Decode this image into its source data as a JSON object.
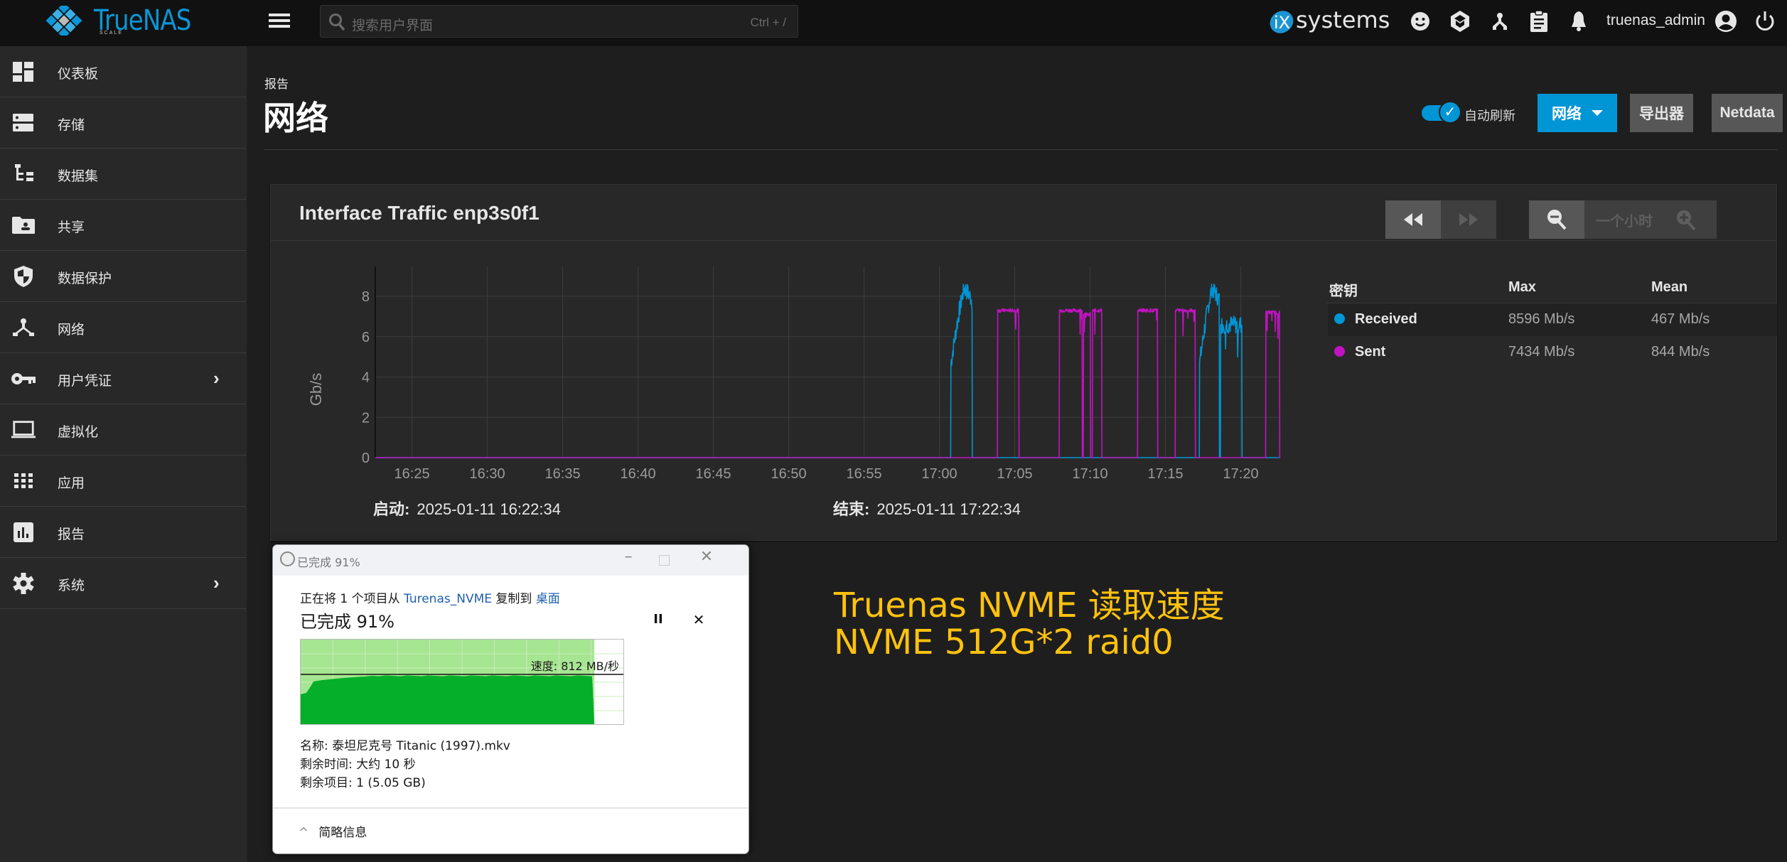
{
  "topbar": {
    "brand": "TrueNAS",
    "brand_sub": "SCALE",
    "search_placeholder": "搜索用户界面",
    "search_hint": "Ctrl + /",
    "vendor": "systems",
    "vendor_prefix": "iX",
    "username": "truenas_admin",
    "icons": [
      "feedback-icon",
      "truecommand-icon",
      "network-status-icon",
      "jobs-clipboard-icon",
      "notifications-bell-icon",
      "account-icon",
      "power-icon"
    ]
  },
  "sidebar": {
    "items": [
      {
        "label": "仪表板",
        "icon": "dashboard-icon",
        "has_children": false
      },
      {
        "label": "存储",
        "icon": "storage-icon",
        "has_children": false
      },
      {
        "label": "数据集",
        "icon": "datasets-icon",
        "has_children": false
      },
      {
        "label": "共享",
        "icon": "shares-icon",
        "has_children": false
      },
      {
        "label": "数据保护",
        "icon": "shield-icon",
        "has_children": false
      },
      {
        "label": "网络",
        "icon": "network-icon",
        "has_children": false
      },
      {
        "label": "用户凭证",
        "icon": "key-icon",
        "has_children": true
      },
      {
        "label": "虚拟化",
        "icon": "laptop-icon",
        "has_children": false
      },
      {
        "label": "应用",
        "icon": "apps-grid-icon",
        "has_children": false
      },
      {
        "label": "报告",
        "icon": "reports-icon",
        "has_children": false
      },
      {
        "label": "系统",
        "icon": "gear-icon",
        "has_children": true
      }
    ]
  },
  "page": {
    "breadcrumb": "报告",
    "title": "网络",
    "auto_refresh_label": "自动刷新",
    "auto_refresh_on": true,
    "report_select_label": "网络",
    "exporters_label": "导出器",
    "netdata_label": "Netdata"
  },
  "card": {
    "title": "Interface Traffic enp3s0f1",
    "zoom_label": "一个小时",
    "start_label": "启动:",
    "start_value": "2025-01-11 16:22:34",
    "end_label": "结束:",
    "end_value": "2025-01-11 17:22:34",
    "legend": {
      "key_header": "密钥",
      "max_header": "Max",
      "mean_header": "Mean",
      "rows": [
        {
          "name": "Received",
          "color": "#0095d5",
          "max": "8596 Mb/s",
          "mean": "467 Mb/s"
        },
        {
          "name": "Sent",
          "color": "#c213c2",
          "max": "7434 Mb/s",
          "mean": "844 Mb/s"
        }
      ]
    }
  },
  "chart_data": {
    "type": "line",
    "title": "Interface Traffic enp3s0f1",
    "xlabel": "",
    "ylabel": "Gb/s",
    "x_range": [
      "16:22:34",
      "17:22:34"
    ],
    "x_ticks": [
      "16:25",
      "16:30",
      "16:35",
      "16:40",
      "16:45",
      "16:50",
      "16:55",
      "17:00",
      "17:05",
      "17:10",
      "17:15",
      "17:20"
    ],
    "y_ticks": [
      0,
      2,
      4,
      6,
      8
    ],
    "ylim": [
      0,
      9.5
    ],
    "grid": true,
    "legend_position": "right",
    "series": [
      {
        "name": "Received",
        "color": "#0095d5",
        "bursts": [
          {
            "start_min": 38.2,
            "end_min": 39.6,
            "level": 7.8,
            "peak": 8.6,
            "ramp": true
          },
          {
            "start_min": 54.7,
            "end_min": 56.0,
            "level": 7.8,
            "peak": 8.6,
            "ramp": true
          },
          {
            "start_min": 56.1,
            "end_min": 57.5,
            "level": 6.6,
            "peak": 7.6,
            "ramp": false
          }
        ]
      },
      {
        "name": "Sent",
        "color": "#c213c2",
        "bursts": [
          {
            "start_min": 41.3,
            "end_min": 42.7,
            "level": 7.3,
            "peak": 7.43,
            "ramp": false
          },
          {
            "start_min": 45.4,
            "end_min": 46.9,
            "level": 7.3,
            "peak": 7.43,
            "ramp": false
          },
          {
            "start_min": 47.0,
            "end_min": 47.45,
            "level": 7.1,
            "peak": 7.2,
            "ramp": false
          },
          {
            "start_min": 47.6,
            "end_min": 48.2,
            "level": 7.3,
            "peak": 7.43,
            "ramp": false
          },
          {
            "start_min": 50.6,
            "end_min": 51.9,
            "level": 7.3,
            "peak": 7.43,
            "ramp": false
          },
          {
            "start_min": 53.1,
            "end_min": 54.4,
            "level": 7.3,
            "peak": 7.43,
            "ramp": false
          },
          {
            "start_min": 59.1,
            "end_min": 60.0,
            "level": 7.2,
            "peak": 7.35,
            "ramp": false
          }
        ]
      }
    ]
  },
  "copy_dialog": {
    "window_title": "已完成 91%",
    "line_prefix": "正在将 1 个项目从 ",
    "source": "Turenas_NVME",
    "line_mid": " 复制到 ",
    "destination": "桌面",
    "progress_text": "已完成 91%",
    "progress_percent": 91,
    "speed_text": "速度: 812 MB/秒",
    "name_line": "名称: 泰坦尼克号 Titanic (1997).mkv",
    "time_left_line": "剩余时间: 大约 10 秒",
    "items_left_line": "剩余项目: 1 (5.05 GB)",
    "details_toggle": "简略信息"
  },
  "annotation": {
    "line1": "Truenas NVME 读取速度",
    "line2": "NVME 512G*2 raid0",
    "color": "#ffc20e"
  }
}
